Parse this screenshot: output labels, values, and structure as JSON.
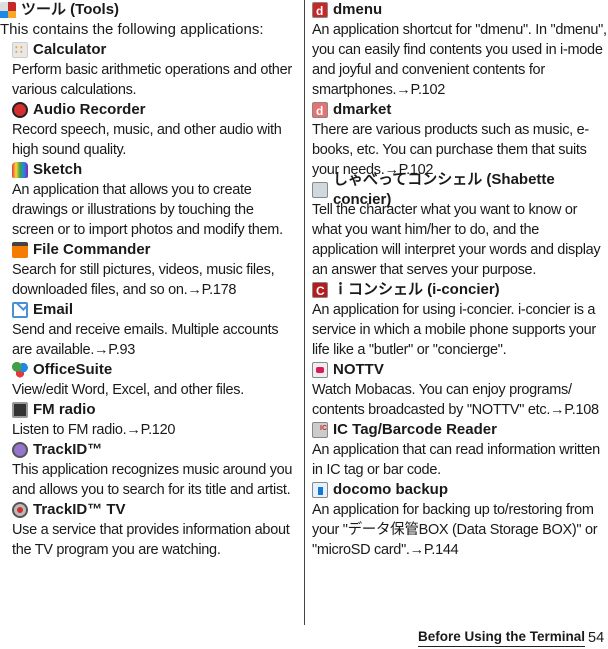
{
  "section": {
    "title": "ツール (Tools)",
    "intro": "This contains the following applications:"
  },
  "apps_left": [
    {
      "icon": "tools-icon",
      "name": "Calculator",
      "desc": "Perform basic arithmetic operations and other various calculations."
    },
    {
      "icon": "audio-recorder-icon",
      "name": "Audio Recorder",
      "desc": "Record speech, music, and other audio with high sound quality."
    },
    {
      "icon": "sketch-icon",
      "name": "Sketch",
      "desc": "An application that allows you to create drawings or illustrations by touching the screen or to import photos and modify them."
    },
    {
      "icon": "file-commander-icon",
      "name": "File Commander",
      "desc": "Search for still pictures, videos, music files, downloaded files, and so on.→P.178"
    },
    {
      "icon": "email-icon",
      "name": "Email",
      "desc": "Send and receive emails. Multiple accounts are available.→P.93"
    },
    {
      "icon": "officesuite-icon",
      "name": "OfficeSuite",
      "desc": "View/edit Word, Excel, and other files."
    },
    {
      "icon": "fm-radio-icon",
      "name": "FM radio",
      "desc": "Listen to FM radio.→P.120"
    },
    {
      "icon": "trackid-icon",
      "name": "TrackID™",
      "desc": "This application recognizes music around you and allows you to search for its title and artist."
    },
    {
      "icon": "trackid-tv-icon",
      "name": "TrackID™ TV",
      "desc": "Use a service that provides information about the TV program you are watching."
    }
  ],
  "apps_right": [
    {
      "icon": "dmenu-icon",
      "name": "dmenu",
      "desc": "An application shortcut for \"dmenu\". In \"dmenu\", you can easily find contents you used in i-mode and joyful and convenient contents for smartphones.→P.102"
    },
    {
      "icon": "dmarket-icon",
      "name": "dmarket",
      "desc": "There are various products such as music, e-books, etc. You can purchase them that suits your needs.→P.102"
    },
    {
      "icon": "shabette-concier-icon",
      "name": "しゃべってコンシェル (Shabette concier)",
      "desc": "Tell the character what you want to know or what you want him/her to do, and the application will interpret your words and display an answer that serves your purpose."
    },
    {
      "icon": "i-concier-icon",
      "name": "ｉコンシェル (i-concier)",
      "desc": "An application for using i-concier. i-concier is a service in which a mobile phone supports your life like a \"butler\" or \"concierge\"."
    },
    {
      "icon": "nottv-icon",
      "name": "NOTTV",
      "desc": "Watch Mobacas. You can enjoy programs/ contents broadcasted by \"NOTTV\" etc.→P.108"
    },
    {
      "icon": "ic-tag-reader-icon",
      "name": "IC Tag/Barcode Reader",
      "desc": "An application that can read information written in IC tag or bar code."
    },
    {
      "icon": "docomo-backup-icon",
      "name": "docomo backup",
      "desc": "An application for backing up to/restoring from your \"データ保管BOX (Data Storage BOX)\" or \"microSD card\".→P.144"
    }
  ],
  "footer": {
    "section_label": "Before Using the Terminal",
    "page_number": "54"
  }
}
